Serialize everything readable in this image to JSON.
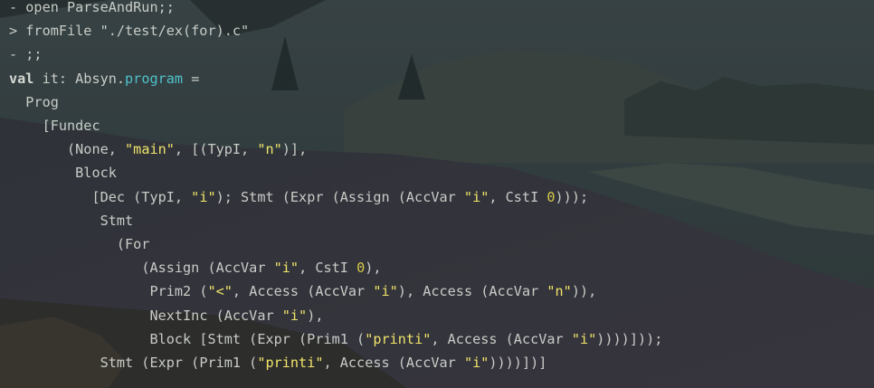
{
  "colors": {
    "text": "#c8ccc6",
    "string": "#f0e46a",
    "number": "#d7c94b",
    "type_highlight": "#4fc1c9"
  },
  "terminal": {
    "lines": [
      {
        "indent": "",
        "tokens": [
          {
            "t": "- open ParseAndRun;;",
            "c": "plain"
          }
        ]
      },
      {
        "indent": "",
        "tokens": [
          {
            "t": "> fromFile \"./test/ex(for).c\"",
            "c": "plain"
          }
        ]
      },
      {
        "indent": "",
        "tokens": [
          {
            "t": "- ;;",
            "c": "plain"
          }
        ]
      },
      {
        "indent": "",
        "tokens": [
          {
            "t": "val",
            "c": "kw"
          },
          {
            "t": " it: Absyn.",
            "c": "plain"
          },
          {
            "t": "program",
            "c": "teal"
          },
          {
            "t": " =",
            "c": "plain"
          }
        ]
      },
      {
        "indent": "  ",
        "tokens": [
          {
            "t": "Prog",
            "c": "plain"
          }
        ]
      },
      {
        "indent": "    ",
        "tokens": [
          {
            "t": "[Fundec",
            "c": "plain"
          }
        ]
      },
      {
        "indent": "       ",
        "tokens": [
          {
            "t": "(None, ",
            "c": "plain"
          },
          {
            "t": "\"main\"",
            "c": "str"
          },
          {
            "t": ", [(TypI, ",
            "c": "plain"
          },
          {
            "t": "\"n\"",
            "c": "str"
          },
          {
            "t": ")],",
            "c": "plain"
          }
        ]
      },
      {
        "indent": "        ",
        "tokens": [
          {
            "t": "Block",
            "c": "plain"
          }
        ]
      },
      {
        "indent": "          ",
        "tokens": [
          {
            "t": "[Dec (TypI, ",
            "c": "plain"
          },
          {
            "t": "\"i\"",
            "c": "str"
          },
          {
            "t": "); Stmt (Expr (Assign (AccVar ",
            "c": "plain"
          },
          {
            "t": "\"i\"",
            "c": "str"
          },
          {
            "t": ", CstI ",
            "c": "plain"
          },
          {
            "t": "0",
            "c": "num"
          },
          {
            "t": ")));",
            "c": "plain"
          }
        ]
      },
      {
        "indent": "           ",
        "tokens": [
          {
            "t": "Stmt",
            "c": "plain"
          }
        ]
      },
      {
        "indent": "             ",
        "tokens": [
          {
            "t": "(For",
            "c": "plain"
          }
        ]
      },
      {
        "indent": "                ",
        "tokens": [
          {
            "t": "(Assign (AccVar ",
            "c": "plain"
          },
          {
            "t": "\"i\"",
            "c": "str"
          },
          {
            "t": ", CstI ",
            "c": "plain"
          },
          {
            "t": "0",
            "c": "num"
          },
          {
            "t": "),",
            "c": "plain"
          }
        ]
      },
      {
        "indent": "                 ",
        "tokens": [
          {
            "t": "Prim2 (",
            "c": "plain"
          },
          {
            "t": "\"<\"",
            "c": "str"
          },
          {
            "t": ", Access (AccVar ",
            "c": "plain"
          },
          {
            "t": "\"i\"",
            "c": "str"
          },
          {
            "t": "), Access (AccVar ",
            "c": "plain"
          },
          {
            "t": "\"n\"",
            "c": "str"
          },
          {
            "t": ")),",
            "c": "plain"
          }
        ]
      },
      {
        "indent": "                 ",
        "tokens": [
          {
            "t": "NextInc (AccVar ",
            "c": "plain"
          },
          {
            "t": "\"i\"",
            "c": "str"
          },
          {
            "t": "),",
            "c": "plain"
          }
        ]
      },
      {
        "indent": "                 ",
        "tokens": [
          {
            "t": "Block [Stmt (Expr (Prim1 (",
            "c": "plain"
          },
          {
            "t": "\"printi\"",
            "c": "str"
          },
          {
            "t": ", Access (AccVar ",
            "c": "plain"
          },
          {
            "t": "\"i\"",
            "c": "str"
          },
          {
            "t": "))))]));",
            "c": "plain"
          }
        ]
      },
      {
        "indent": "           ",
        "tokens": [
          {
            "t": "Stmt (Expr (Prim1 (",
            "c": "plain"
          },
          {
            "t": "\"printi\"",
            "c": "str"
          },
          {
            "t": ", Access (AccVar ",
            "c": "plain"
          },
          {
            "t": "\"i\"",
            "c": "str"
          },
          {
            "t": "))))])]",
            "c": "plain"
          }
        ]
      }
    ]
  }
}
